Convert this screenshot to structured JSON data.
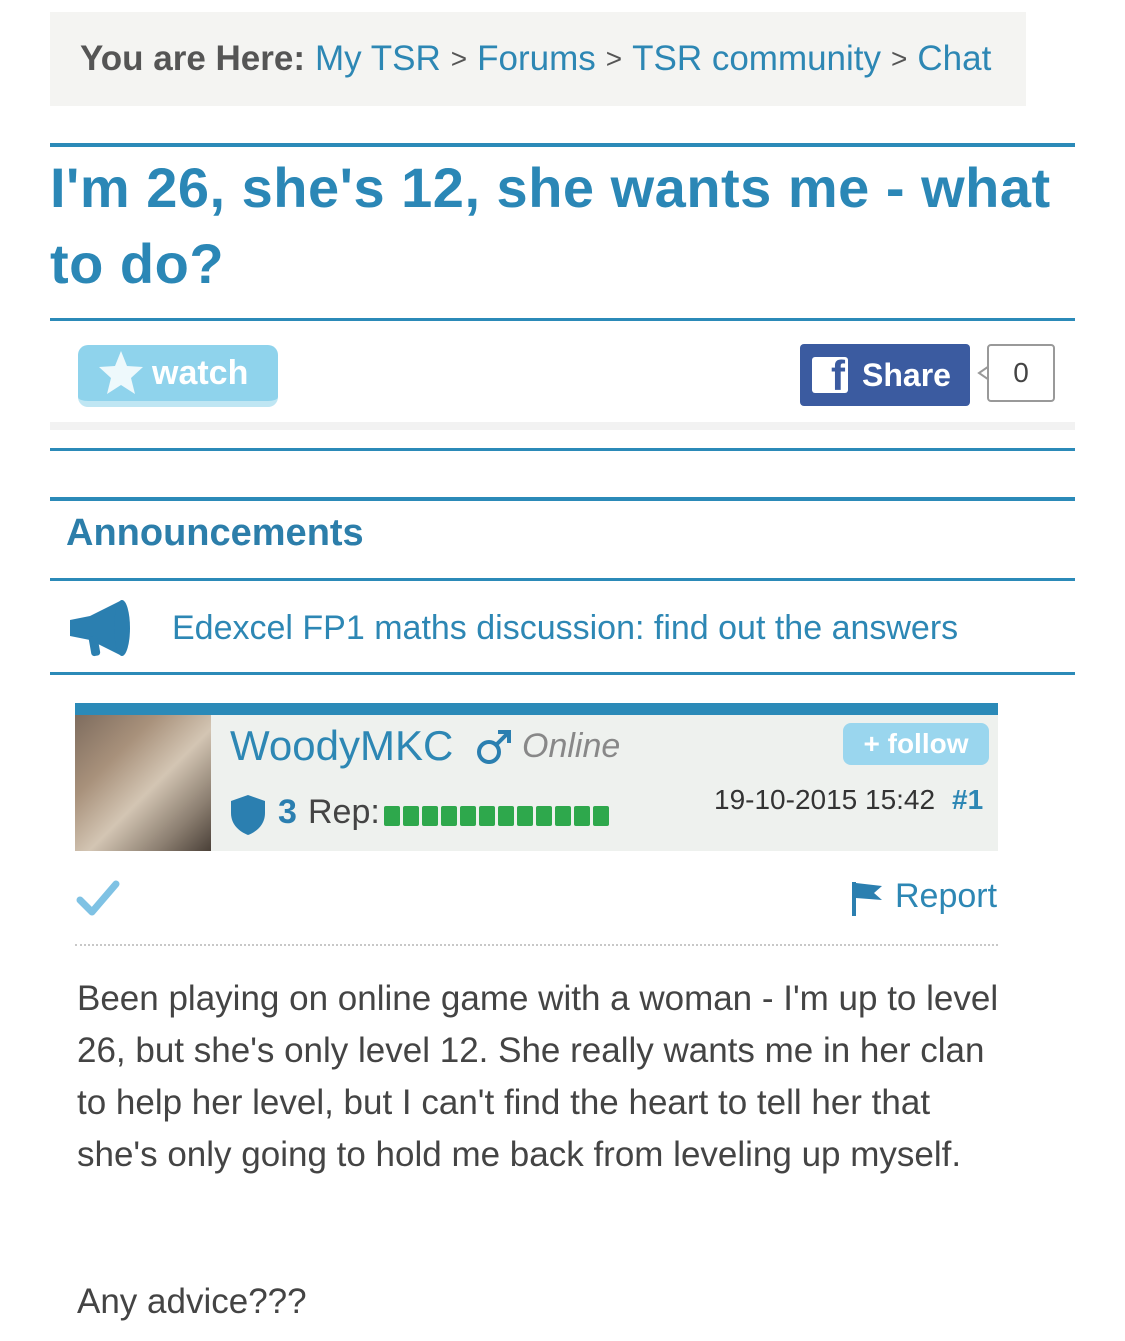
{
  "breadcrumb": {
    "label": "You are Here:",
    "items": [
      "My TSR",
      "Forums",
      "TSR community",
      "Chat"
    ],
    "separator": ">"
  },
  "thread": {
    "title": "I'm 26, she's 12, she wants me - what to do?"
  },
  "actions": {
    "watch_label": "watch",
    "share_label": "Share",
    "share_count": "0"
  },
  "announcements": {
    "heading": "Announcements",
    "item": "Edexcel FP1 maths discussion: find out the answers"
  },
  "post": {
    "username": "WoodyMKC",
    "status": "Online",
    "follow_label": "+ follow",
    "rep_number": "3",
    "rep_label": "Rep:",
    "rep_level": 12,
    "timestamp": "19-10-2015 15:42",
    "post_number": "#1",
    "report_label": "Report",
    "body": "Been playing on online game with a woman - I'm up to level 26, but she's only level 12. She really wants me in her clan to help her level, but I can't find the heart to tell her that she's only going to hold me back from leveling up myself.",
    "closing": "Any advice???"
  },
  "colors": {
    "accent": "#2b8ab8",
    "link": "#2d87b4",
    "facebook": "#3b5ba0",
    "rep_green": "#2ea84c"
  },
  "icons": [
    "star-icon",
    "facebook-icon",
    "megaphone-icon",
    "male-icon",
    "shield-icon",
    "checkmark-icon",
    "flag-icon"
  ]
}
